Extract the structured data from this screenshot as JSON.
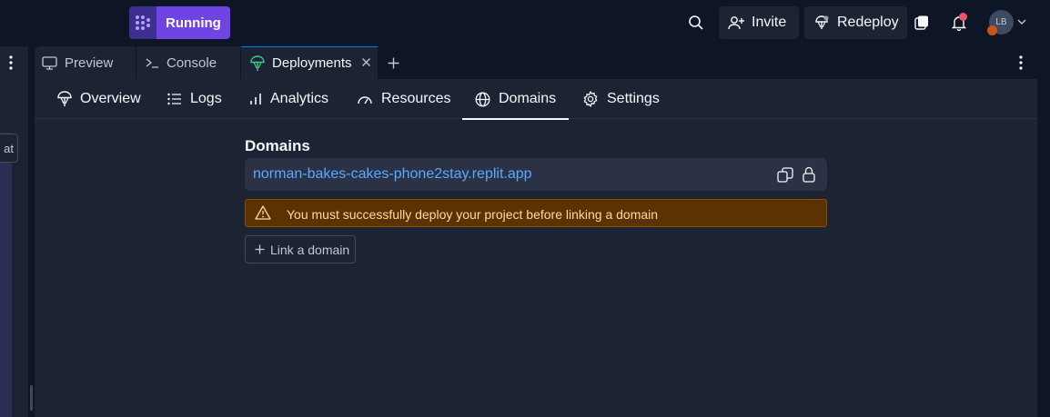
{
  "topbar": {
    "run_label": "Running",
    "invite_label": "Invite",
    "redeploy_label": "Redeploy",
    "avatar_initials": "LB"
  },
  "left_panel": {
    "chat_button_partial": "at"
  },
  "tabs": [
    {
      "label": "Preview",
      "icon": "monitor-icon"
    },
    {
      "label": "Console",
      "icon": "terminal-icon"
    },
    {
      "label": "Deployments",
      "icon": "deploy-icon",
      "active": true
    }
  ],
  "subnav": [
    {
      "label": "Overview",
      "icon": "deploy-icon"
    },
    {
      "label": "Logs",
      "icon": "list-icon"
    },
    {
      "label": "Analytics",
      "icon": "bar-chart-icon"
    },
    {
      "label": "Resources",
      "icon": "gauge-icon"
    },
    {
      "label": "Domains",
      "icon": "globe-icon",
      "active": true
    },
    {
      "label": "Settings",
      "icon": "gear-icon"
    }
  ],
  "domains": {
    "title": "Domains",
    "url": "norman-bakes-cakes-phone2stay.replit.app",
    "warning": "You must successfully deploy your project before linking a domain",
    "link_button": "Link a domain"
  },
  "colors": {
    "accent": "#6f44e3",
    "link": "#57abff",
    "warning_bg": "#5c3200"
  }
}
